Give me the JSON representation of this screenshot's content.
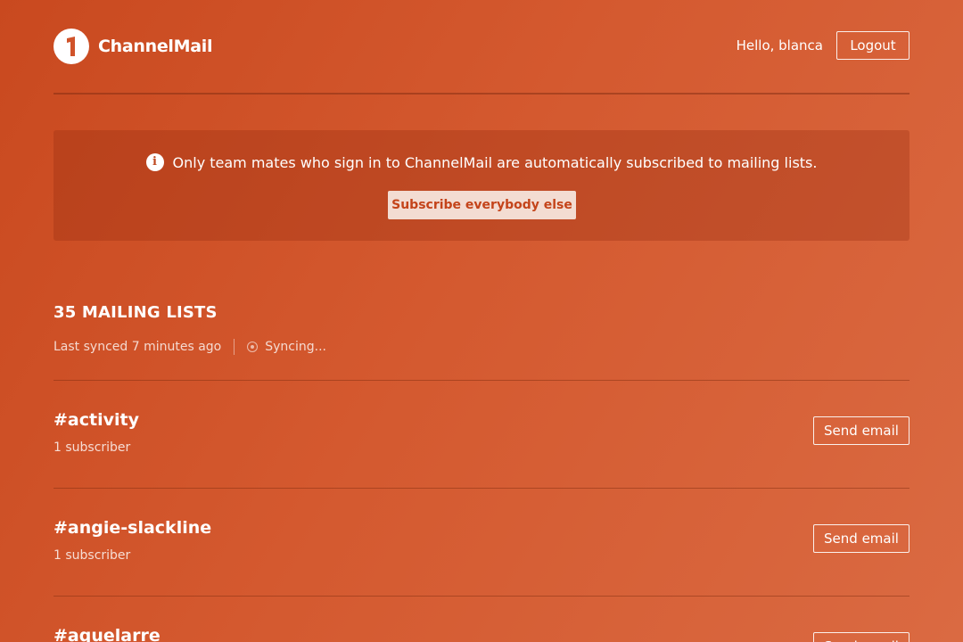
{
  "header": {
    "brand": "ChannelMail",
    "greeting": "Hello, blanca",
    "logout_label": "Logout"
  },
  "notice": {
    "icon": "info-icon",
    "message": "Only team mates who sign in to ChannelMail are automatically subscribed to mailing lists.",
    "button_label": "Subscribe everybody else"
  },
  "lists": {
    "title": "35 MAILING LISTS",
    "last_synced": "Last synced 7 minutes ago",
    "sync_status": "Syncing...",
    "items": [
      {
        "name": "#activity",
        "subscribers": "1 subscriber",
        "action": "Send email"
      },
      {
        "name": "#angie-slackline",
        "subscribers": "1 subscriber",
        "action": "Send email"
      },
      {
        "name": "#aquelarre",
        "subscribers": "",
        "action": "Send email"
      }
    ]
  },
  "colors": {
    "background_start": "#c9491f",
    "background_end": "#da6a42",
    "button_text": "#c4441a",
    "button_bg": "#f3dcd2"
  }
}
